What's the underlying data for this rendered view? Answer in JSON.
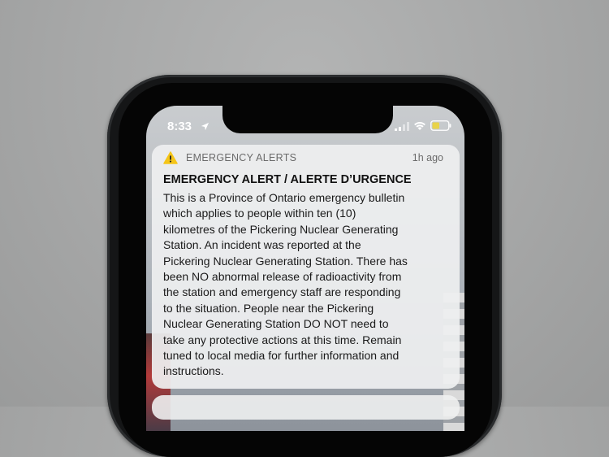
{
  "status_bar": {
    "time": "8:33",
    "icons": [
      "location-arrow-icon",
      "signal-icon",
      "wifi-icon",
      "battery-icon"
    ],
    "battery_color": "#e8d34a"
  },
  "notification": {
    "app_name": "EMERGENCY ALERTS",
    "time_ago": "1h ago",
    "icon": "warning-icon",
    "icon_color": "#f5c518",
    "title": "EMERGENCY ALERT / ALERTE D’URGENCE",
    "body_lines": [
      "This is a Province of Ontario emergency bulletin",
      "which applies to people within ten (10)",
      "kilometres of the Pickering Nuclear Generating",
      "Station. An incident was reported at the",
      "Pickering Nuclear Generating Station. There has",
      "been NO abnormal release of radioactivity from",
      "the station and emergency staff are responding",
      "to the situation. People near the Pickering",
      "Nuclear Generating Station DO NOT need to",
      "take any protective actions at this time. Remain",
      "tuned to local media for further information and",
      "instructions."
    ]
  }
}
